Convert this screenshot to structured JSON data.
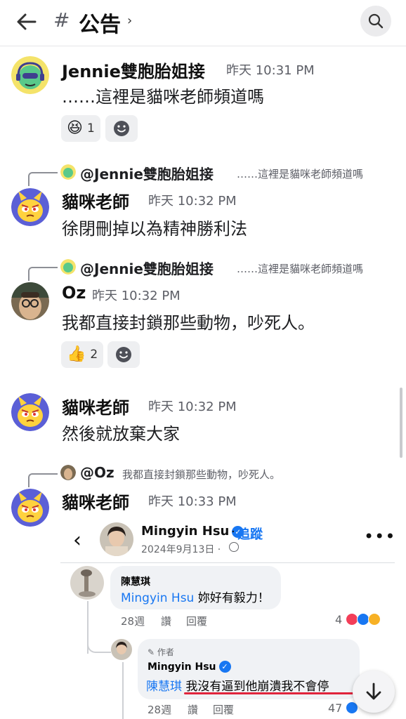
{
  "header": {
    "hash": "#",
    "channel_name": "公告",
    "chevron": "›",
    "back_icon": "arrow-left-icon",
    "search_icon": "search-icon"
  },
  "messages": [
    {
      "author": "Jennie雙胞胎姐接",
      "time": "昨天 10:31 PM",
      "text": "……這裡是貓咪老師頻道嗎",
      "reactions": [
        {
          "emoji": "😆",
          "count": "1"
        }
      ]
    },
    {
      "reply_to": {
        "name": "@Jennie雙胞胎姐接",
        "text": "……這裡是貓咪老師頻道嗎"
      },
      "author": "貓咪老師",
      "time": "昨天 10:32 PM",
      "text": "徐閉刪掉以為精神勝利法"
    },
    {
      "reply_to": {
        "name": "@Jennie雙胞胎姐接",
        "text": "……這裡是貓咪老師頻道嗎"
      },
      "author": "Oz",
      "time": "昨天 10:32 PM",
      "text": "我都直接封鎖那些動物，吵死人。",
      "reactions": [
        {
          "emoji": "👍",
          "count": "2"
        }
      ]
    },
    {
      "author": "貓咪老師",
      "time": "昨天 10:32 PM",
      "text": "然後就放棄大家"
    },
    {
      "reply_to": {
        "name": "@Oz",
        "text": "我都直接封鎖那些動物，吵死人。"
      },
      "author": "貓咪老師",
      "time": "昨天 10:33 PM",
      "text": ""
    }
  ],
  "embed": {
    "back": "‹",
    "poster": "Mingyin Hsu",
    "verified": "✓",
    "dot": "·",
    "follow": "追蹤",
    "date": "2024年9月13日 ·",
    "more": "•••",
    "comments": [
      {
        "author": "陳慧琪",
        "mention": "Mingyin Hsu",
        "text": " 妳好有毅力！",
        "age": "28週",
        "like": "讚",
        "reply": "回覆",
        "count": "4"
      },
      {
        "badge": "作者",
        "author": "Mingyin Hsu",
        "mention": "陳慧琪",
        "text": " 我沒有逼到他崩潰我不會停",
        "age": "28週",
        "like": "讚",
        "reply": "回覆",
        "count": "47"
      }
    ]
  },
  "jump_icon": "arrow-down-icon",
  "colors": {
    "accent_blue": "#1877f2",
    "highlight_red": "#e0243c",
    "muted_text": "#5c5e66",
    "reaction_bg": "#eeeff1"
  }
}
